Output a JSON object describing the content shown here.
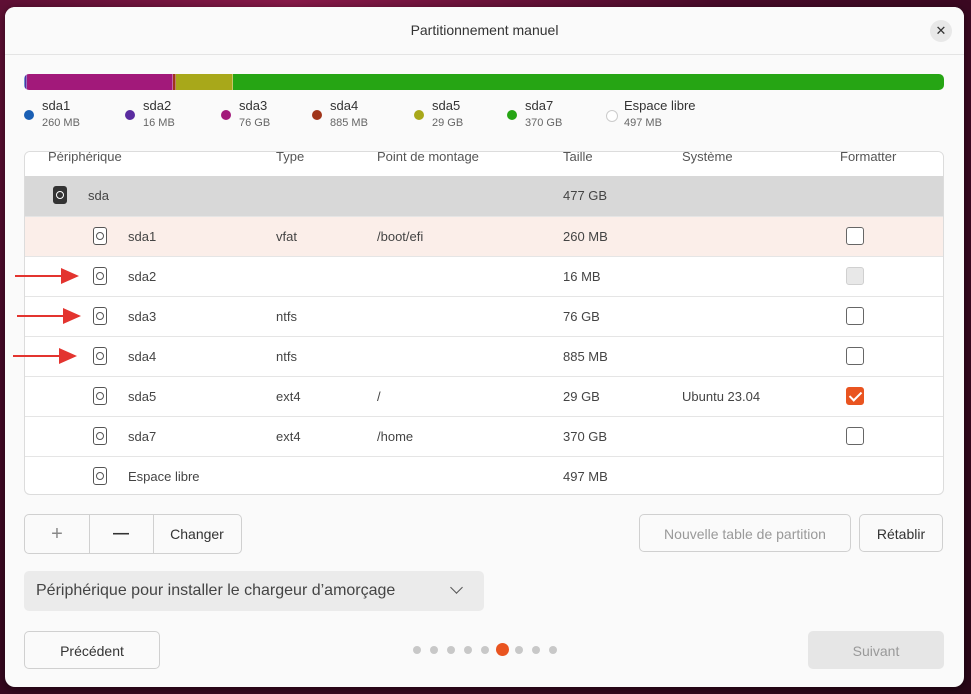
{
  "window": {
    "title": "Partitionnement manuel",
    "close_symbol": "✕"
  },
  "usage_bar": [
    {
      "name": "sda1",
      "fraction": 0.0005,
      "color": "#1a5fb4"
    },
    {
      "name": "sda2",
      "fraction": 0.0001,
      "color": "#5a2ca0"
    },
    {
      "name": "sda3",
      "fraction": 0.1594,
      "color": "#a2197a"
    },
    {
      "name": "sda4",
      "fraction": 0.0019,
      "color": "#a0351a"
    },
    {
      "name": "sda5",
      "fraction": 0.0608,
      "color": "#a8a81a"
    },
    {
      "name": "sda7",
      "fraction": 0.7773,
      "color": "#26a514"
    }
  ],
  "legend": [
    {
      "name": "sda1",
      "size": "260 MB",
      "color": "#1a5fb4"
    },
    {
      "name": "sda2",
      "size": "16 MB",
      "color": "#5a2ca0"
    },
    {
      "name": "sda3",
      "size": "76 GB",
      "color": "#a2197a"
    },
    {
      "name": "sda4",
      "size": "885 MB",
      "color": "#a0351a"
    },
    {
      "name": "sda5",
      "size": "29 GB",
      "color": "#a8a81a"
    },
    {
      "name": "sda7",
      "size": "370 GB",
      "color": "#26a514"
    },
    {
      "name": "Espace libre",
      "size": "497 MB",
      "color": "#ffffff"
    }
  ],
  "table": {
    "headers": {
      "device": "Périphérique",
      "type": "Type",
      "mount": "Point de montage",
      "size": "Taille",
      "system": "Système",
      "format": "Formatter"
    },
    "device": {
      "name": "sda",
      "size": "477 GB"
    },
    "rows": [
      {
        "name": "sda1",
        "type": "vfat",
        "mount": "/boot/efi",
        "size": "260 MB",
        "system": "",
        "format": "unchecked",
        "selected": true
      },
      {
        "name": "sda2",
        "type": "",
        "mount": "",
        "size": "16 MB",
        "system": "",
        "format": "disabled",
        "selected": false
      },
      {
        "name": "sda3",
        "type": "ntfs",
        "mount": "",
        "size": "76 GB",
        "system": "",
        "format": "unchecked",
        "selected": false
      },
      {
        "name": "sda4",
        "type": "ntfs",
        "mount": "",
        "size": "885 MB",
        "system": "",
        "format": "unchecked",
        "selected": false
      },
      {
        "name": "sda5",
        "type": "ext4",
        "mount": "/",
        "size": "29 GB",
        "system": "Ubuntu 23.04",
        "format": "checked",
        "selected": false
      },
      {
        "name": "sda7",
        "type": "ext4",
        "mount": "/home",
        "size": "370 GB",
        "system": "",
        "format": "unchecked",
        "selected": false
      },
      {
        "name": "Espace libre",
        "type": "",
        "mount": "",
        "size": "497 MB",
        "system": "",
        "format": "none",
        "selected": false
      }
    ]
  },
  "buttons": {
    "add": "+",
    "remove": "—",
    "change": "Changer",
    "new_table": "Nouvelle table de partition",
    "revert": "Rétablir",
    "previous": "Précédent",
    "next": "Suivant"
  },
  "bootloader": {
    "label": "Périphérique pour installer le chargeur d’amorçage"
  },
  "pager": {
    "count": 9,
    "active": 6
  }
}
